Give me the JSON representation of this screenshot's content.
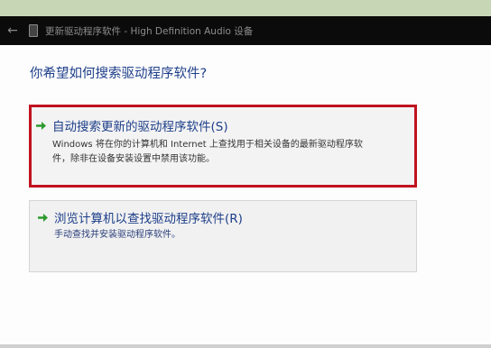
{
  "window": {
    "title": "更新驱动程序软件 - High Definition Audio 设备",
    "back_icon": "back-arrow-icon",
    "device_icon": "audio-device-icon"
  },
  "main": {
    "question": "你希望如何搜索驱动程序软件?",
    "options": [
      {
        "title": "自动搜索更新的驱动程序软件(S)",
        "description_line1": "Windows 将在你的计算机和 Internet 上查找用于相关设备的最新驱动程序软",
        "description_line2": "件，除非在设备安装设置中禁用该功能。",
        "icon": "green-arrow-icon",
        "highlighted": true,
        "highlight_color": "#c1121f"
      },
      {
        "title": "浏览计算机以查找驱动程序软件(R)",
        "description_line1": "手动查找并安装驱动程序软件。",
        "icon": "green-arrow-icon",
        "highlighted": false
      }
    ]
  },
  "colors": {
    "accent_text": "#1e3f8a",
    "arrow_green": "#2e9a2e",
    "titlebar": "#0b0b0b"
  }
}
